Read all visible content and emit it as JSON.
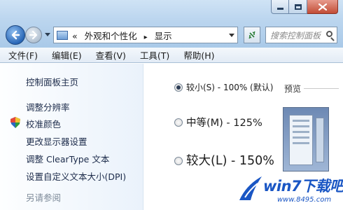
{
  "window": {
    "minimize_icon": "minimize-icon",
    "maximize_icon": "maximize-icon",
    "close_icon": "close-icon",
    "close_color": "#c24d36"
  },
  "navigation": {
    "back_icon": "back-arrow-icon",
    "forward_icon": "forward-arrow-icon",
    "breadcrumb": {
      "prefix": "«",
      "parent": "外观和个性化",
      "separator": "▸",
      "current": "显示"
    },
    "refresh_icon": "refresh-icon",
    "search_placeholder": "搜索控制面板"
  },
  "menu": [
    {
      "label": "文件(F)"
    },
    {
      "label": "编辑(E)"
    },
    {
      "label": "查看(V)"
    },
    {
      "label": "工具(T)"
    },
    {
      "label": "帮助(H)"
    }
  ],
  "task_pane": {
    "items": [
      {
        "label": "控制面板主页"
      },
      {
        "label": "调整分辨率"
      },
      {
        "label": "校准颜色"
      },
      {
        "label": "更改显示器设置"
      },
      {
        "label": "调整 ClearType 文本"
      },
      {
        "label": "设置自定义文本大小(DPI)"
      }
    ],
    "see_also": "另请参阅"
  },
  "options": [
    {
      "label": "较小(S) - 100% (默认)",
      "selected": true
    },
    {
      "label": "中等(M) - 125%",
      "selected": false
    },
    {
      "label": "较大(L) - 150%",
      "selected": false
    }
  ],
  "preview": {
    "label": "预览"
  },
  "watermark": {
    "text": "win7下载吧",
    "url": "www.8495.com"
  },
  "colors": {
    "accent": "#1a56c4",
    "link": "#1c2b4a"
  }
}
